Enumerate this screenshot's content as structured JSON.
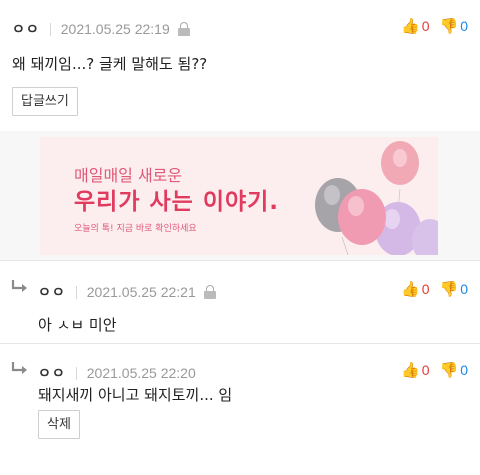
{
  "comments": [
    {
      "nickname": "ㅇㅇ",
      "date": "2021.05.25 22:19",
      "text": "왜 돼끼임...? 글케 말해도 됨??",
      "action_label": "답글쓰기",
      "likes": "0",
      "dislikes": "0"
    },
    {
      "nickname": "ㅇㅇ",
      "date": "2021.05.25 22:21",
      "text": "아 ㅅㅂ 미안",
      "likes": "0",
      "dislikes": "0"
    },
    {
      "nickname": "ㅇㅇ",
      "date": "2021.05.25 22:20",
      "text": "돼지새끼 아니고 돼지토끼... 임",
      "action_label": "삭제",
      "likes": "0",
      "dislikes": "0"
    }
  ],
  "ad": {
    "line1": "매일매일 새로운",
    "line2": "우리가 사는 이야기.",
    "line3": "오늘의 톡! 지금 바로 확인하세요"
  },
  "icons": {
    "like": "thumbs-up-icon",
    "dislike": "thumbs-down-icon",
    "lock": "lock-icon",
    "reply": "reply-arrow-icon"
  },
  "colors": {
    "like": "#e53935",
    "dislike": "#1e88e5",
    "ad_text": "#e03a5f"
  }
}
